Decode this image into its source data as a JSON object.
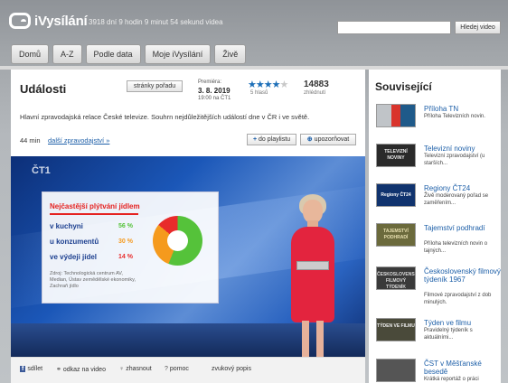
{
  "header": {
    "logo_text": "iVysílání",
    "tagline": "3918 dní 9 hodin 9 minut 54 sekund videa",
    "search_placeholder": "",
    "search_button": "Hledej video"
  },
  "nav": {
    "tabs": [
      {
        "label": "Domů"
      },
      {
        "label": "A-Z"
      },
      {
        "label": "Podle data"
      },
      {
        "label": "Moje iVysílání"
      },
      {
        "label": "Živě"
      }
    ]
  },
  "program": {
    "title": "Události",
    "page_button": "stránky pořadu",
    "premiere_label": "Premiéra:",
    "premiere_date": "3. 8. 2019",
    "premiere_channel": "19:00 na ČT1",
    "rating_stars": "★★★★",
    "rating_stars_off": "★",
    "rating_value": 4,
    "votes": "5 hlasů",
    "views": "14883",
    "views_label": "zhlédnutí",
    "description": "Hlavní zpravodajská relace České televize. Souhrn nejdůležitějších událostí dne v ČR i ve světě.",
    "duration": "44 min",
    "more_link": "další zpravodajství »",
    "playlist_button": "do playlistu",
    "notify_button": "upozorňovat"
  },
  "video": {
    "channel_logo": "ČT1",
    "card": {
      "heading": "Nejčastější plýtvání jídlem",
      "rows": [
        {
          "label": "v kuchyni",
          "value": "56 %",
          "color": "#55c23a"
        },
        {
          "label": "u konzumentů",
          "value": "30 %",
          "color": "#f59a1d"
        },
        {
          "label": "ve výdeji jídel",
          "value": "14 %",
          "color": "#e82b2b"
        }
      ],
      "source_note": "Zdroj: Technologická centrum AV, Median, Ústav zemědělské ekonomiky, Zachraň jídlo"
    }
  },
  "share": {
    "share": "sdílet",
    "link": "odkaz na video",
    "ask": "zhasnout",
    "help": "pomoc",
    "audio": "zvukový popis"
  },
  "sidebar": {
    "title": "Související",
    "items": [
      {
        "title": "Příloha TN",
        "desc": "Příloha Televizních novin.",
        "thumb": ""
      },
      {
        "title": "Televizní noviny",
        "desc": "Televizní zpravodajství (u starších...",
        "thumb": "TELEVIZNÍ NOVINY"
      },
      {
        "title": "Regiony ČT24",
        "desc": "Živě moderovaný pořad se zaměřením...",
        "thumb": "Regiony ČT24"
      },
      {
        "title": "Tajemství podhradí",
        "desc": "Příloha televizních novin o tajných...",
        "thumb": "TAJEMSTVÍ PODHRADÍ"
      },
      {
        "title": "Československý filmový týdeník 1967",
        "desc": "Filmové zpravodajství z dob minulých.",
        "thumb": "ČESKOSLOVENSKÝ FILMOVÝ TÝDENÍK"
      },
      {
        "title": "Týden ve filmu",
        "desc": "Pravidelný týdeník s aktuálními...",
        "thumb": "TÝDEN VE FILMU"
      },
      {
        "title": "ČST v Měšťanské besedě",
        "desc": "Krátká reportáž o práci",
        "thumb": ""
      }
    ]
  },
  "colors": {
    "link": "#1d5fa8",
    "accent_red": "#e52220",
    "star": "#1d6fb8"
  }
}
